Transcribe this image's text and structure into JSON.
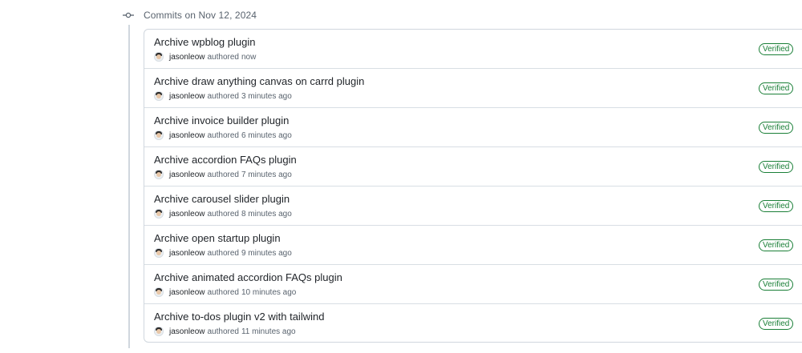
{
  "group": {
    "title": "Commits on Nov 12, 2024",
    "icon": "git-commit-icon"
  },
  "commits": [
    {
      "title": "Archive wpblog plugin",
      "author": "jasonleow",
      "authored": "authored",
      "time": "now",
      "badge": "Verified"
    },
    {
      "title": "Archive draw anything canvas on carrd plugin",
      "author": "jasonleow",
      "authored": "authored",
      "time": "3 minutes ago",
      "badge": "Verified"
    },
    {
      "title": "Archive invoice builder plugin",
      "author": "jasonleow",
      "authored": "authored",
      "time": "6 minutes ago",
      "badge": "Verified"
    },
    {
      "title": "Archive accordion FAQs plugin",
      "author": "jasonleow",
      "authored": "authored",
      "time": "7 minutes ago",
      "badge": "Verified"
    },
    {
      "title": "Archive carousel slider plugin",
      "author": "jasonleow",
      "authored": "authored",
      "time": "8 minutes ago",
      "badge": "Verified"
    },
    {
      "title": "Archive open startup plugin",
      "author": "jasonleow",
      "authored": "authored",
      "time": "9 minutes ago",
      "badge": "Verified"
    },
    {
      "title": "Archive animated accordion FAQs plugin",
      "author": "jasonleow",
      "authored": "authored",
      "time": "10 minutes ago",
      "badge": "Verified"
    },
    {
      "title": "Archive to-dos plugin v2 with tailwind",
      "author": "jasonleow",
      "authored": "authored",
      "time": "11 minutes ago",
      "badge": "Verified"
    }
  ],
  "colors": {
    "verified": "#1a7f37",
    "border": "#d0d7de",
    "muted_text": "#59636e",
    "primary_text": "#1f2328"
  }
}
